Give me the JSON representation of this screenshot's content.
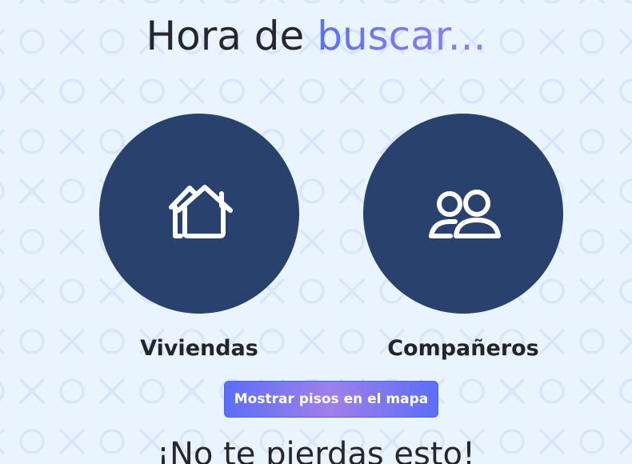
{
  "colors": {
    "background": "#eaf4fe",
    "pattern": "#d8e6fb",
    "circle": "#29426d",
    "accent_gradient_start": "#5a72f2",
    "accent_gradient_end": "#9b7ef0",
    "text": "#25272b"
  },
  "header": {
    "title_prefix": "Hora de ",
    "title_accent": "buscar..."
  },
  "options": [
    {
      "label": "Viviendas",
      "icon": "house-icon"
    },
    {
      "label": "Compañeros",
      "icon": "users-icon"
    }
  ],
  "map_button": {
    "label": "Mostrar pisos en el mapa"
  },
  "promo": {
    "title": "¡No te pierdas esto!"
  }
}
